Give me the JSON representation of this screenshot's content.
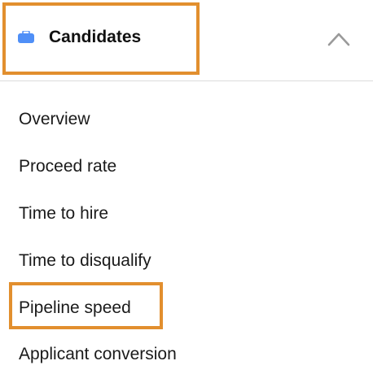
{
  "header": {
    "title": "Candidates",
    "icon": "briefcase-icon",
    "icon_color": "#4f8ff7",
    "collapse_icon": "chevron-up-icon",
    "highlight_color": "#e28f2e"
  },
  "menu": {
    "items": [
      {
        "label": "Overview"
      },
      {
        "label": "Proceed rate"
      },
      {
        "label": "Time to hire"
      },
      {
        "label": "Time to disqualify"
      },
      {
        "label": "Pipeline speed",
        "highlighted": true
      },
      {
        "label": "Applicant conversion"
      }
    ]
  }
}
